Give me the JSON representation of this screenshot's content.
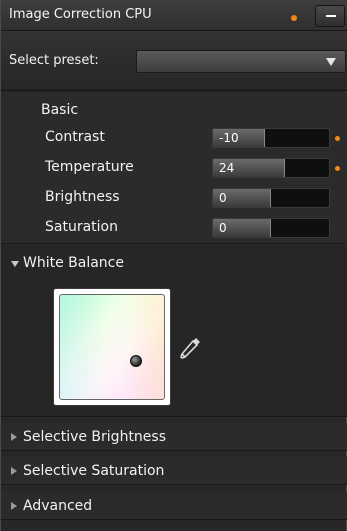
{
  "window": {
    "title": "Image Correction CPU"
  },
  "colors": {
    "modified_indicator": "#f08a14",
    "panel_bg": "#272727"
  },
  "preset": {
    "label": "Select preset:",
    "selected_value": ""
  },
  "basic": {
    "heading": "Basic",
    "rows": [
      {
        "label": "Contrast",
        "value": "-10",
        "fill_fraction": 0.45,
        "modified": true
      },
      {
        "label": "Temperature",
        "value": "24",
        "fill_fraction": 0.62,
        "modified": true
      },
      {
        "label": "Brightness",
        "value": "0",
        "fill_fraction": 0.5,
        "modified": false
      },
      {
        "label": "Saturation",
        "value": "0",
        "fill_fraction": 0.5,
        "modified": false
      }
    ]
  },
  "white_balance": {
    "label": "White Balance",
    "expanded": true,
    "icons": {
      "eyedropper": "eyedropper-icon"
    }
  },
  "sections": [
    {
      "label": "Selective Brightness",
      "expanded": false
    },
    {
      "label": "Selective Saturation",
      "expanded": false
    },
    {
      "label": "Advanced",
      "expanded": false
    }
  ]
}
